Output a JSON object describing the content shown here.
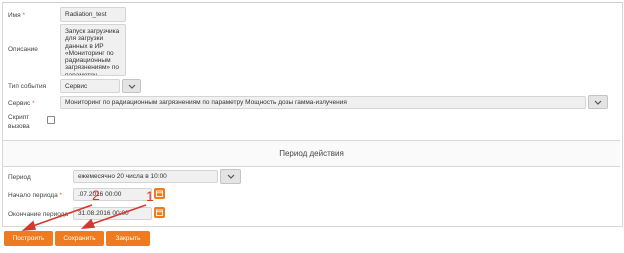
{
  "form": {
    "name_label": "Имя",
    "name_value": "Radiation_test",
    "description_label": "Описание",
    "description_value": "Запуск загрузчика для загрузки данных в ИР «Мониторинг по радиационным загрязнениям» по параметру «Мощность дозы гамма-излучение»",
    "event_type_label": "Тип события",
    "event_type_value": "Сервис",
    "service_label": "Сервис",
    "service_value": "Мониторинг по радиационным загрязнениям по параметру Мощность дозы гамма-излучения",
    "script_label_1": "Скрипт",
    "script_label_2": "вызова",
    "required_mark": "*"
  },
  "period": {
    "section_title": "Период действия",
    "period_label": "Период",
    "period_value": "ежемесячно 20 числа в 10:00",
    "start_label": "Начало периода",
    "start_value": ".07.2016 00:00",
    "end_label": "Окончание периода",
    "end_value": "31.08.2016 00:00"
  },
  "buttons": {
    "build": "Построить",
    "save": "Сохранить",
    "close": "Закрыть"
  },
  "annotations": {
    "marker_1": "1",
    "marker_2": "2"
  },
  "colors": {
    "accent": "#f07b1e",
    "annotation": "#d4382e"
  }
}
